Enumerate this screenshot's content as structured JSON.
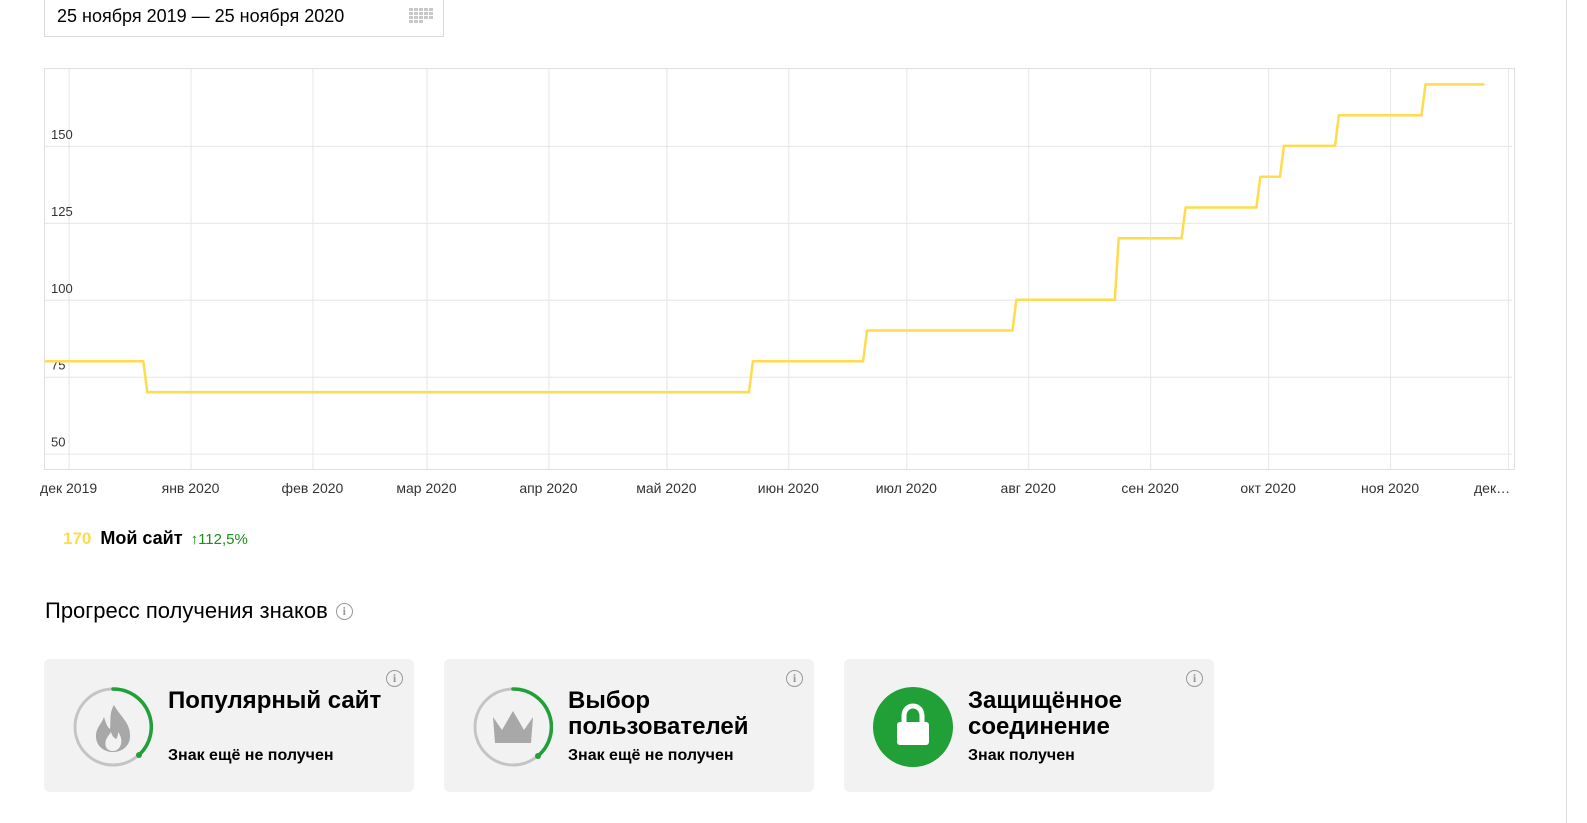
{
  "date_range": {
    "label": "25 ноября 2019 — 25 ноября 2020"
  },
  "chart_data": {
    "type": "line",
    "step": true,
    "series": [
      {
        "name": "Мой сайт",
        "color": "#ffdb4d",
        "points": [
          {
            "x": "2019-11-25",
            "y": 80
          },
          {
            "x": "2019-12-20",
            "y": 80
          },
          {
            "x": "2019-12-21",
            "y": 70
          },
          {
            "x": "2020-05-22",
            "y": 70
          },
          {
            "x": "2020-05-23",
            "y": 80
          },
          {
            "x": "2020-06-20",
            "y": 80
          },
          {
            "x": "2020-06-21",
            "y": 90
          },
          {
            "x": "2020-07-28",
            "y": 90
          },
          {
            "x": "2020-07-29",
            "y": 100
          },
          {
            "x": "2020-08-23",
            "y": 100
          },
          {
            "x": "2020-08-24",
            "y": 120
          },
          {
            "x": "2020-09-09",
            "y": 120
          },
          {
            "x": "2020-09-10",
            "y": 130
          },
          {
            "x": "2020-09-28",
            "y": 130
          },
          {
            "x": "2020-09-29",
            "y": 140
          },
          {
            "x": "2020-10-04",
            "y": 140
          },
          {
            "x": "2020-10-05",
            "y": 150
          },
          {
            "x": "2020-10-18",
            "y": 150
          },
          {
            "x": "2020-10-19",
            "y": 160
          },
          {
            "x": "2020-11-09",
            "y": 160
          },
          {
            "x": "2020-11-10",
            "y": 170
          },
          {
            "x": "2020-11-25",
            "y": 170
          }
        ]
      }
    ],
    "y_ticks": [
      50,
      75,
      100,
      125,
      150
    ],
    "ylim": [
      45,
      175
    ],
    "x_ticks": [
      {
        "x": "2019-12-01",
        "label": "дек 2019"
      },
      {
        "x": "2020-01-01",
        "label": "янв 2020"
      },
      {
        "x": "2020-02-01",
        "label": "фев 2020"
      },
      {
        "x": "2020-03-01",
        "label": "мар 2020"
      },
      {
        "x": "2020-04-01",
        "label": "апр 2020"
      },
      {
        "x": "2020-05-01",
        "label": "май 2020"
      },
      {
        "x": "2020-06-01",
        "label": "июн 2020"
      },
      {
        "x": "2020-07-01",
        "label": "июл 2020"
      },
      {
        "x": "2020-08-01",
        "label": "авг 2020"
      },
      {
        "x": "2020-09-01",
        "label": "сен 2020"
      },
      {
        "x": "2020-10-01",
        "label": "окт 2020"
      },
      {
        "x": "2020-11-01",
        "label": "ноя 2020"
      },
      {
        "x": "2020-12-01",
        "label": "дек…"
      }
    ],
    "xlim": [
      "2019-11-25",
      "2020-12-02"
    ],
    "grid": true
  },
  "legend": {
    "value": "170",
    "name": "Мой сайт",
    "change": "↑112,5%",
    "value_color": "#ffdb4d",
    "change_color": "#1a8f1a"
  },
  "progress": {
    "title": "Прогресс получения знаков",
    "info_icon": "info-icon",
    "badges": [
      {
        "title": "Популярный сайт",
        "status": "Знак ещё не получен",
        "icon": "flame-icon",
        "received": false,
        "progress": 0.25
      },
      {
        "title": "Выбор пользователей",
        "status": "Знак ещё не получен",
        "icon": "crown-icon",
        "received": false,
        "progress": 0.37
      },
      {
        "title": "Защищённое соединение",
        "status": "Знак получен",
        "icon": "lock-icon",
        "received": true,
        "progress": 1
      }
    ]
  },
  "colors": {
    "accent_green": "#21a038",
    "line_yellow": "#ffdb4d",
    "card_bg": "#f2f2f2"
  }
}
